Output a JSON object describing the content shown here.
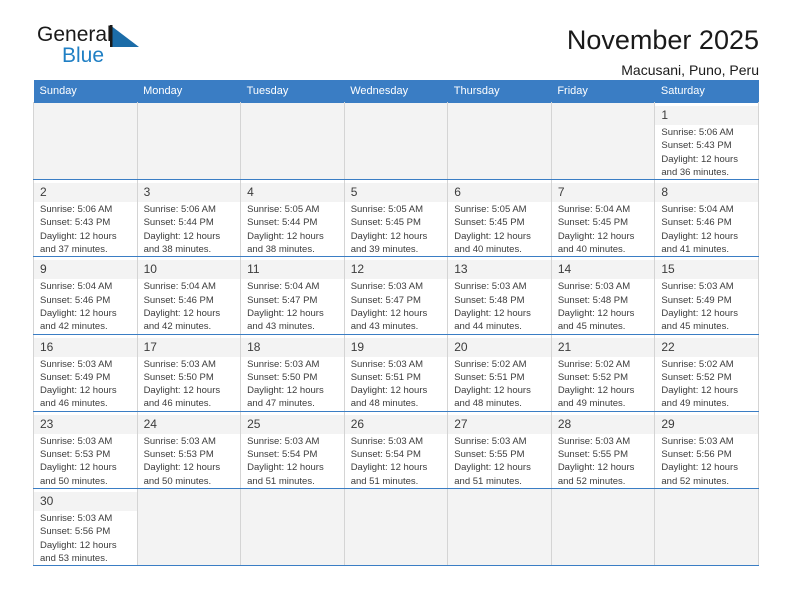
{
  "branding": {
    "name_part1": "General",
    "name_part2": "Blue",
    "flag_icon": "blue-triangle-flag-icon",
    "accent_color": "#1f7fc4"
  },
  "header": {
    "title": "November 2025",
    "subtitle": "Macusani, Puno, Peru"
  },
  "theme": {
    "header_row_bg": "#3a7dc4",
    "cell_border": "#3a7dc4",
    "daynum_bg": "#f3f3f3",
    "empty_cell_bg": "#f3f3f3",
    "text_color": "#3c3c3c"
  },
  "calendar": {
    "weekday_headers": [
      "Sunday",
      "Monday",
      "Tuesday",
      "Wednesday",
      "Thursday",
      "Friday",
      "Saturday"
    ],
    "labels": {
      "sunrise": "Sunrise:",
      "sunset": "Sunset:",
      "daylight": "Daylight:"
    },
    "weeks": [
      [
        {
          "empty": true
        },
        {
          "empty": true
        },
        {
          "empty": true
        },
        {
          "empty": true
        },
        {
          "empty": true
        },
        {
          "empty": true
        },
        {
          "day": "1",
          "sunrise": "Sunrise: 5:06 AM",
          "sunset": "Sunset: 5:43 PM",
          "daylight_line1": "Daylight: 12 hours",
          "daylight_line2": "and 36 minutes."
        }
      ],
      [
        {
          "day": "2",
          "sunrise": "Sunrise: 5:06 AM",
          "sunset": "Sunset: 5:43 PM",
          "daylight_line1": "Daylight: 12 hours",
          "daylight_line2": "and 37 minutes."
        },
        {
          "day": "3",
          "sunrise": "Sunrise: 5:06 AM",
          "sunset": "Sunset: 5:44 PM",
          "daylight_line1": "Daylight: 12 hours",
          "daylight_line2": "and 38 minutes."
        },
        {
          "day": "4",
          "sunrise": "Sunrise: 5:05 AM",
          "sunset": "Sunset: 5:44 PM",
          "daylight_line1": "Daylight: 12 hours",
          "daylight_line2": "and 38 minutes."
        },
        {
          "day": "5",
          "sunrise": "Sunrise: 5:05 AM",
          "sunset": "Sunset: 5:45 PM",
          "daylight_line1": "Daylight: 12 hours",
          "daylight_line2": "and 39 minutes."
        },
        {
          "day": "6",
          "sunrise": "Sunrise: 5:05 AM",
          "sunset": "Sunset: 5:45 PM",
          "daylight_line1": "Daylight: 12 hours",
          "daylight_line2": "and 40 minutes."
        },
        {
          "day": "7",
          "sunrise": "Sunrise: 5:04 AM",
          "sunset": "Sunset: 5:45 PM",
          "daylight_line1": "Daylight: 12 hours",
          "daylight_line2": "and 40 minutes."
        },
        {
          "day": "8",
          "sunrise": "Sunrise: 5:04 AM",
          "sunset": "Sunset: 5:46 PM",
          "daylight_line1": "Daylight: 12 hours",
          "daylight_line2": "and 41 minutes."
        }
      ],
      [
        {
          "day": "9",
          "sunrise": "Sunrise: 5:04 AM",
          "sunset": "Sunset: 5:46 PM",
          "daylight_line1": "Daylight: 12 hours",
          "daylight_line2": "and 42 minutes."
        },
        {
          "day": "10",
          "sunrise": "Sunrise: 5:04 AM",
          "sunset": "Sunset: 5:46 PM",
          "daylight_line1": "Daylight: 12 hours",
          "daylight_line2": "and 42 minutes."
        },
        {
          "day": "11",
          "sunrise": "Sunrise: 5:04 AM",
          "sunset": "Sunset: 5:47 PM",
          "daylight_line1": "Daylight: 12 hours",
          "daylight_line2": "and 43 minutes."
        },
        {
          "day": "12",
          "sunrise": "Sunrise: 5:03 AM",
          "sunset": "Sunset: 5:47 PM",
          "daylight_line1": "Daylight: 12 hours",
          "daylight_line2": "and 43 minutes."
        },
        {
          "day": "13",
          "sunrise": "Sunrise: 5:03 AM",
          "sunset": "Sunset: 5:48 PM",
          "daylight_line1": "Daylight: 12 hours",
          "daylight_line2": "and 44 minutes."
        },
        {
          "day": "14",
          "sunrise": "Sunrise: 5:03 AM",
          "sunset": "Sunset: 5:48 PM",
          "daylight_line1": "Daylight: 12 hours",
          "daylight_line2": "and 45 minutes."
        },
        {
          "day": "15",
          "sunrise": "Sunrise: 5:03 AM",
          "sunset": "Sunset: 5:49 PM",
          "daylight_line1": "Daylight: 12 hours",
          "daylight_line2": "and 45 minutes."
        }
      ],
      [
        {
          "day": "16",
          "sunrise": "Sunrise: 5:03 AM",
          "sunset": "Sunset: 5:49 PM",
          "daylight_line1": "Daylight: 12 hours",
          "daylight_line2": "and 46 minutes."
        },
        {
          "day": "17",
          "sunrise": "Sunrise: 5:03 AM",
          "sunset": "Sunset: 5:50 PM",
          "daylight_line1": "Daylight: 12 hours",
          "daylight_line2": "and 46 minutes."
        },
        {
          "day": "18",
          "sunrise": "Sunrise: 5:03 AM",
          "sunset": "Sunset: 5:50 PM",
          "daylight_line1": "Daylight: 12 hours",
          "daylight_line2": "and 47 minutes."
        },
        {
          "day": "19",
          "sunrise": "Sunrise: 5:03 AM",
          "sunset": "Sunset: 5:51 PM",
          "daylight_line1": "Daylight: 12 hours",
          "daylight_line2": "and 48 minutes."
        },
        {
          "day": "20",
          "sunrise": "Sunrise: 5:02 AM",
          "sunset": "Sunset: 5:51 PM",
          "daylight_line1": "Daylight: 12 hours",
          "daylight_line2": "and 48 minutes."
        },
        {
          "day": "21",
          "sunrise": "Sunrise: 5:02 AM",
          "sunset": "Sunset: 5:52 PM",
          "daylight_line1": "Daylight: 12 hours",
          "daylight_line2": "and 49 minutes."
        },
        {
          "day": "22",
          "sunrise": "Sunrise: 5:02 AM",
          "sunset": "Sunset: 5:52 PM",
          "daylight_line1": "Daylight: 12 hours",
          "daylight_line2": "and 49 minutes."
        }
      ],
      [
        {
          "day": "23",
          "sunrise": "Sunrise: 5:03 AM",
          "sunset": "Sunset: 5:53 PM",
          "daylight_line1": "Daylight: 12 hours",
          "daylight_line2": "and 50 minutes."
        },
        {
          "day": "24",
          "sunrise": "Sunrise: 5:03 AM",
          "sunset": "Sunset: 5:53 PM",
          "daylight_line1": "Daylight: 12 hours",
          "daylight_line2": "and 50 minutes."
        },
        {
          "day": "25",
          "sunrise": "Sunrise: 5:03 AM",
          "sunset": "Sunset: 5:54 PM",
          "daylight_line1": "Daylight: 12 hours",
          "daylight_line2": "and 51 minutes."
        },
        {
          "day": "26",
          "sunrise": "Sunrise: 5:03 AM",
          "sunset": "Sunset: 5:54 PM",
          "daylight_line1": "Daylight: 12 hours",
          "daylight_line2": "and 51 minutes."
        },
        {
          "day": "27",
          "sunrise": "Sunrise: 5:03 AM",
          "sunset": "Sunset: 5:55 PM",
          "daylight_line1": "Daylight: 12 hours",
          "daylight_line2": "and 51 minutes."
        },
        {
          "day": "28",
          "sunrise": "Sunrise: 5:03 AM",
          "sunset": "Sunset: 5:55 PM",
          "daylight_line1": "Daylight: 12 hours",
          "daylight_line2": "and 52 minutes."
        },
        {
          "day": "29",
          "sunrise": "Sunrise: 5:03 AM",
          "sunset": "Sunset: 5:56 PM",
          "daylight_line1": "Daylight: 12 hours",
          "daylight_line2": "and 52 minutes."
        }
      ],
      [
        {
          "day": "30",
          "sunrise": "Sunrise: 5:03 AM",
          "sunset": "Sunset: 5:56 PM",
          "daylight_line1": "Daylight: 12 hours",
          "daylight_line2": "and 53 minutes."
        },
        {
          "empty": true
        },
        {
          "empty": true
        },
        {
          "empty": true
        },
        {
          "empty": true
        },
        {
          "empty": true
        },
        {
          "empty": true
        }
      ]
    ]
  }
}
